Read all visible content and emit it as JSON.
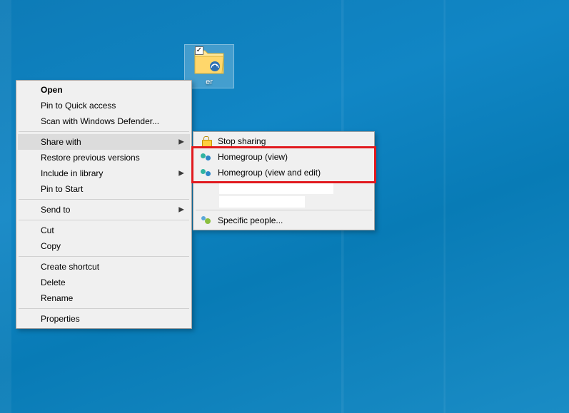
{
  "desktop_icon": {
    "label": "er"
  },
  "context_menu": {
    "open": "Open",
    "pin_quick_access": "Pin to Quick access",
    "scan_windows_defender": "Scan with Windows Defender...",
    "share_with": "Share with",
    "restore_previous_versions": "Restore previous versions",
    "include_in_library": "Include in library",
    "pin_to_start": "Pin to Start",
    "send_to": "Send to",
    "cut": "Cut",
    "copy": "Copy",
    "create_shortcut": "Create shortcut",
    "delete": "Delete",
    "rename": "Rename",
    "properties": "Properties"
  },
  "share_submenu": {
    "stop_sharing": "Stop sharing",
    "homegroup_view": "Homegroup (view)",
    "homegroup_view_edit": "Homegroup (view and edit)",
    "specific_people": "Specific people..."
  }
}
